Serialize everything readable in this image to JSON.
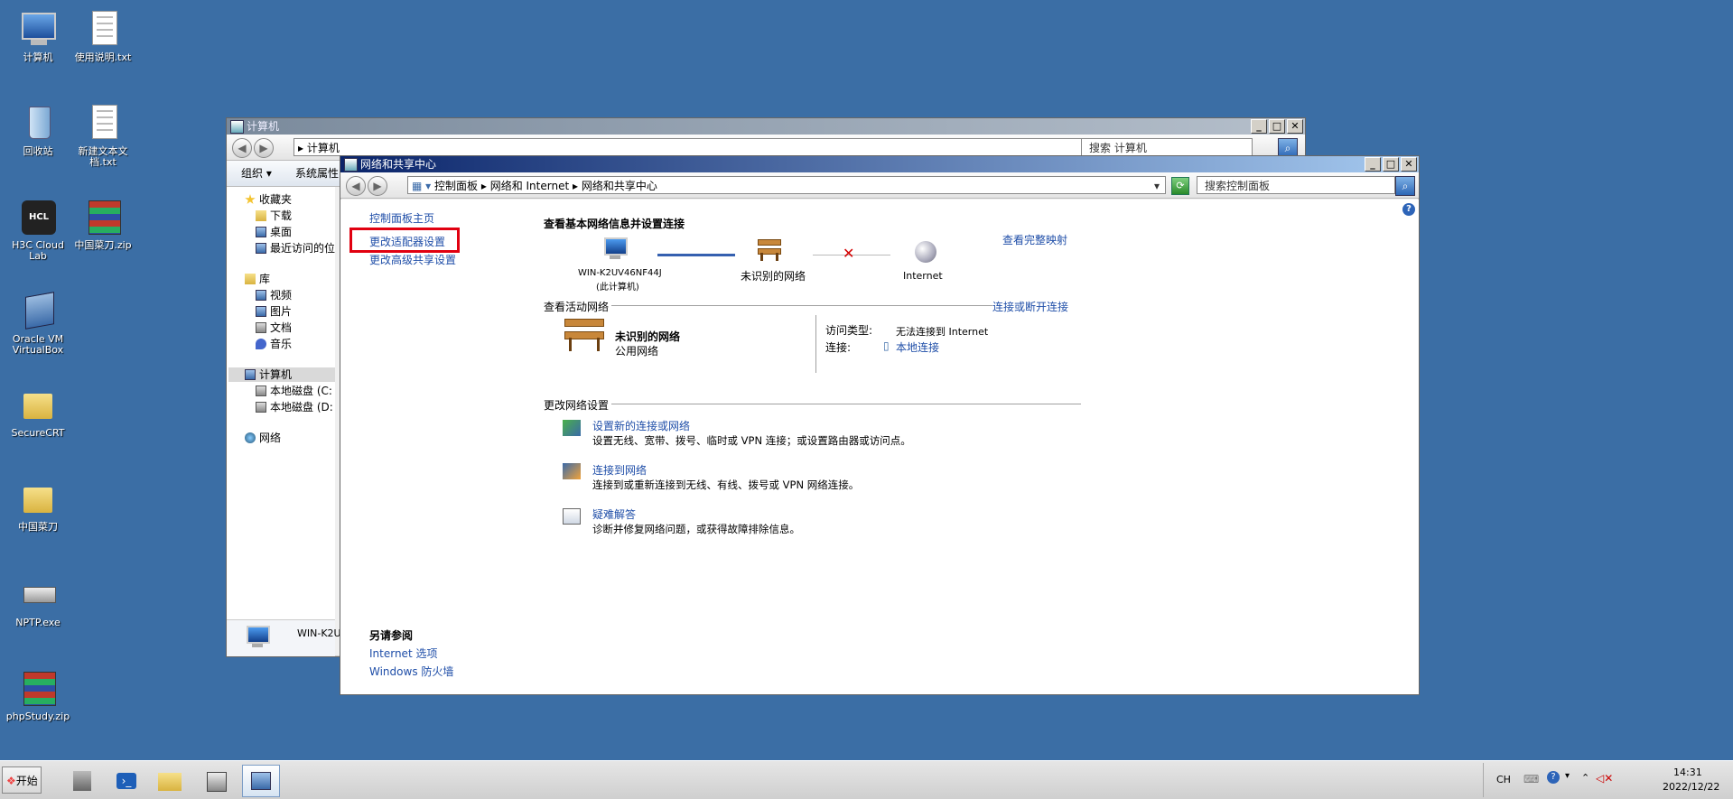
{
  "desktop": {
    "icons": [
      {
        "label": "计算机"
      },
      {
        "label": "使用说明.txt"
      },
      {
        "label": "回收站"
      },
      {
        "label": "新建文本文\n档.txt"
      },
      {
        "label": "H3C Cloud\nLab"
      },
      {
        "label": "中国菜刀.zip"
      },
      {
        "label": "Oracle VM\nVirtualBox"
      },
      {
        "label": "SecureCRT"
      },
      {
        "label": "中国菜刀"
      },
      {
        "label": "NPTP.exe"
      },
      {
        "label": "phpStudy.zip"
      }
    ]
  },
  "explorer": {
    "title": "计算机",
    "address": "计算机",
    "search_placeholder": "搜索 计算机",
    "toolbar": {
      "organize": "组织 ▾",
      "system_props": "系统属性"
    },
    "tree": {
      "favorites": "收藏夹",
      "downloads": "下载",
      "desktop": "桌面",
      "recent": "最近访问的位",
      "libraries": "库",
      "videos": "视频",
      "pictures": "图片",
      "documents": "文档",
      "music": "音乐",
      "computer": "计算机",
      "disk_c": "本地磁盘 (C:",
      "disk_d": "本地磁盘 (D:",
      "network": "网络"
    },
    "details_name": "WIN-K2U"
  },
  "network_center": {
    "title": "网络和共享中心",
    "breadcrumb": {
      "part1": "控制面板",
      "part2": "网络和 Internet",
      "part3": "网络和共享中心"
    },
    "search_placeholder": "搜索控制面板",
    "help": "?",
    "left": {
      "home": "控制面板主页",
      "change_adapter": "更改适配器设置",
      "advanced_sharing": "更改高级共享设置",
      "see_also": "另请参阅",
      "internet_options": "Internet 选项",
      "firewall": "Windows 防火墙"
    },
    "main": {
      "heading": "查看基本网络信息并设置连接",
      "view_full_map": "查看完整映射",
      "map": {
        "computer_name": "WIN-K2UV46NF44J",
        "computer_sub": "(此计算机)",
        "network": "未识别的网络",
        "internet": "Internet"
      },
      "active_networks": "查看活动网络",
      "connect_disconnect": "连接或断开连接",
      "network_name": "未识别的网络",
      "network_type": "公用网络",
      "access_type_label": "访问类型:",
      "access_type_value": "无法连接到 Internet",
      "connections_label": "连接:",
      "connections_value": "本地连接",
      "change_settings": "更改网络设置",
      "tasks": [
        {
          "title": "设置新的连接或网络",
          "desc": "设置无线、宽带、拨号、临时或 VPN 连接；或设置路由器或访问点。"
        },
        {
          "title": "连接到网络",
          "desc": "连接到或重新连接到无线、有线、拨号或 VPN 网络连接。"
        },
        {
          "title": "疑难解答",
          "desc": "诊断并修复网络问题，或获得故障排除信息。"
        }
      ]
    }
  },
  "taskbar": {
    "start": "开始",
    "lang": "CH",
    "time": "14:31",
    "date": "2022/12/22"
  }
}
